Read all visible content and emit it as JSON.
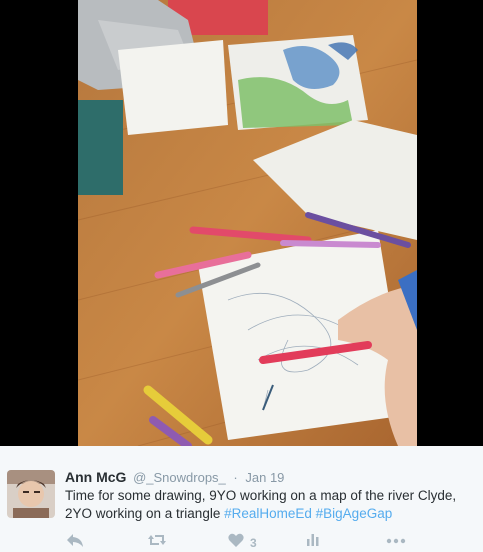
{
  "tweet": {
    "name": "Ann McG",
    "handle": "@_Snowdrops_",
    "separator": "·",
    "time": "Jan 19",
    "text_before": "Time for some drawing, 9YO working on a map of the river Clyde, 2YO working on a triangle ",
    "hashtags": [
      "#RealHomeEd",
      "#BigAgeGap"
    ]
  },
  "actions": {
    "reply_icon": "reply-icon",
    "retweet_icon": "retweet-icon",
    "like_icon": "heart-icon",
    "like_count": "3",
    "analytics_icon": "bar-chart-icon",
    "more_icon": "more-dots-icon"
  },
  "colors": {
    "link": "#55acee",
    "muted": "#aab8c2",
    "text": "#292f33",
    "background": "#f5f8fa"
  }
}
